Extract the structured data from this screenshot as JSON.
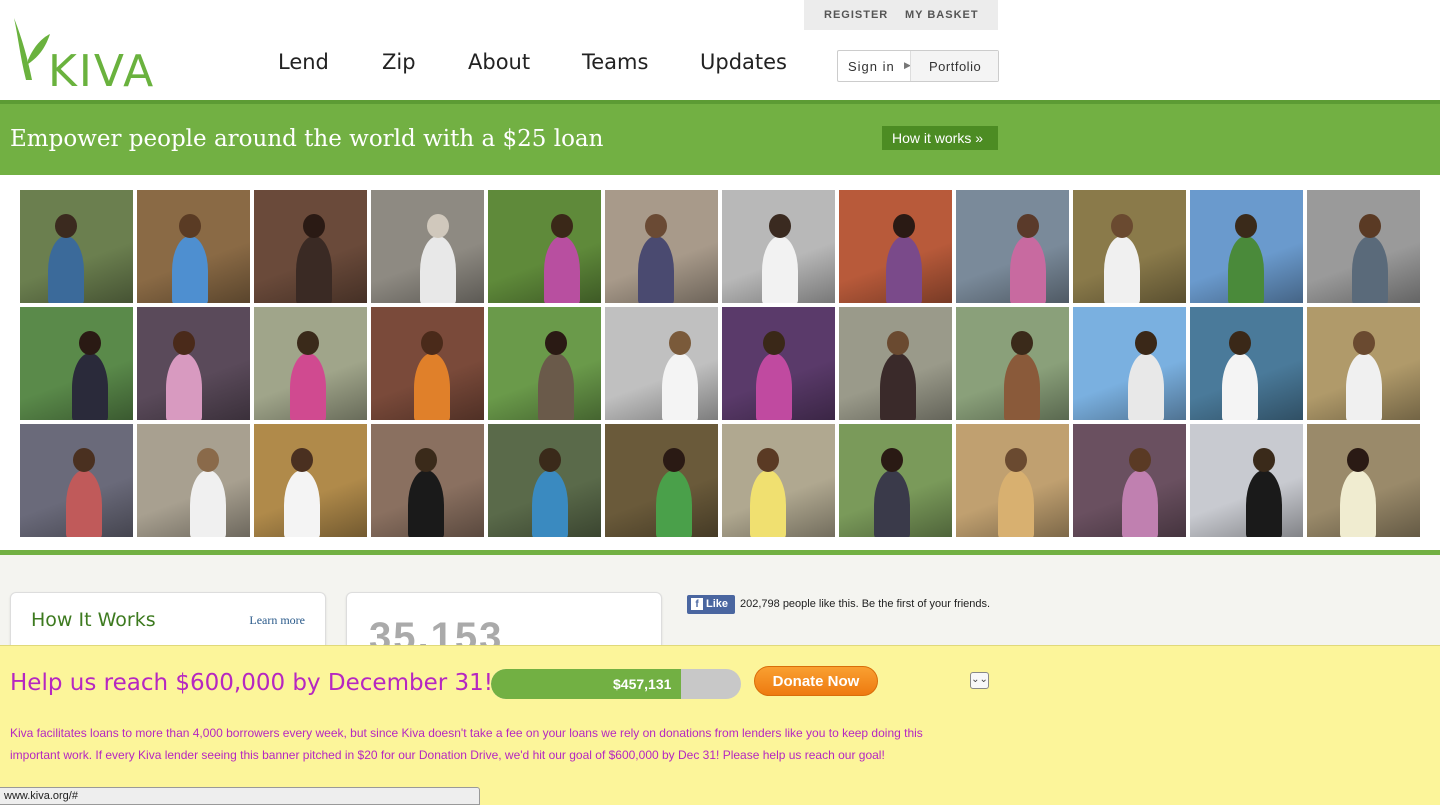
{
  "header": {
    "logo_text": "KIVA",
    "nav": [
      "Lend",
      "Zip",
      "About",
      "Teams",
      "Updates"
    ],
    "util": {
      "register": "REGISTER",
      "basket": "MY BASKET"
    },
    "signin": {
      "label": "Sign in",
      "portfolio": "Portfolio"
    }
  },
  "banner": {
    "title": "Empower people around the world with a $25 loan",
    "how_it_works": "How it works »"
  },
  "photos": [
    {
      "bg": "#6b7f4f",
      "fig": "#3b6a9a",
      "head": "#3b2a1f"
    },
    {
      "bg": "#8a6a45",
      "fig": "#4e8fd0",
      "head": "#5a3b24"
    },
    {
      "bg": "#6a4a3a",
      "fig": "#3a2a24",
      "head": "#2a1a14"
    },
    {
      "bg": "#8e8a82",
      "fig": "#e8e8e8",
      "head": "#d0c8bc"
    },
    {
      "bg": "#5f8a3a",
      "fig": "#b84fa0",
      "head": "#3a2818"
    },
    {
      "bg": "#a89a8a",
      "fig": "#4a4a70",
      "head": "#6a4a34"
    },
    {
      "bg": "#b8b8b8",
      "fig": "#f2f2f2",
      "head": "#3a2a20"
    },
    {
      "bg": "#b85a3a",
      "fig": "#7a4a8a",
      "head": "#2a1a14"
    },
    {
      "bg": "#7a8a9a",
      "fig": "#c86aa0",
      "head": "#5a3a2a"
    },
    {
      "bg": "#8a7a4a",
      "fig": "#f0f0f0",
      "head": "#6a4a30"
    },
    {
      "bg": "#6a9acd",
      "fig": "#4a8a3a",
      "head": "#3a2a1a"
    },
    {
      "bg": "#9a9a9a",
      "fig": "#5a6a7a",
      "head": "#5a3a24"
    },
    {
      "bg": "#5a8a4a",
      "fig": "#2a2a3a",
      "head": "#2a1a14"
    },
    {
      "bg": "#5a4a5a",
      "fig": "#d89ac0",
      "head": "#4a2a1a"
    },
    {
      "bg": "#a0a58a",
      "fig": "#d04a90",
      "head": "#3a2a1a"
    },
    {
      "bg": "#7a4a3a",
      "fig": "#e0802a",
      "head": "#4a2a1a"
    },
    {
      "bg": "#6a9a4a",
      "fig": "#6a5a4a",
      "head": "#2a1a14"
    },
    {
      "bg": "#c0c0c0",
      "fig": "#f4f4f4",
      "head": "#7a5a3a"
    },
    {
      "bg": "#5a3a6a",
      "fig": "#c04aa0",
      "head": "#3a2818"
    },
    {
      "bg": "#9a9a8a",
      "fig": "#3a2a2a",
      "head": "#6a4a30"
    },
    {
      "bg": "#8aa07a",
      "fig": "#8a5a3a",
      "head": "#3a2a1a"
    },
    {
      "bg": "#7ab0e0",
      "fig": "#e8e8e8",
      "head": "#3a2818"
    },
    {
      "bg": "#4a7a9a",
      "fig": "#f4f4f4",
      "head": "#3a2818"
    },
    {
      "bg": "#b09a6a",
      "fig": "#f0f0f0",
      "head": "#6a4a30"
    },
    {
      "bg": "#6a6a7a",
      "fig": "#c05a5a",
      "head": "#4a3020"
    },
    {
      "bg": "#a8a090",
      "fig": "#f0f0f0",
      "head": "#8a6a4a"
    },
    {
      "bg": "#b08a4a",
      "fig": "#f4f4f4",
      "head": "#4a3020"
    },
    {
      "bg": "#8a7060",
      "fig": "#1a1a1a",
      "head": "#3a2a1a"
    },
    {
      "bg": "#5a6a4a",
      "fig": "#3a8ac0",
      "head": "#3a2a1a"
    },
    {
      "bg": "#6a5a3a",
      "fig": "#4aa04a",
      "head": "#2a1a14"
    },
    {
      "bg": "#b0a890",
      "fig": "#f0e070",
      "head": "#5a3a24"
    },
    {
      "bg": "#7a9a5a",
      "fig": "#3a3a4a",
      "head": "#2a1a14"
    },
    {
      "bg": "#c0a070",
      "fig": "#d8b070",
      "head": "#6a4a30"
    },
    {
      "bg": "#6a5060",
      "fig": "#c080b0",
      "head": "#5a3a24"
    },
    {
      "bg": "#c8cad0",
      "fig": "#1a1a1a",
      "head": "#3a2a1a"
    },
    {
      "bg": "#9a8a6a",
      "fig": "#f0ecd0",
      "head": "#2a1a14"
    }
  ],
  "cards": {
    "how_it_works": {
      "title": "How It Works",
      "learn_more": "Learn more"
    },
    "counter": "35,153"
  },
  "facebook": {
    "like": "Like",
    "text": "202,798 people like this. Be the first of your friends."
  },
  "donation": {
    "title": "Help us reach $600,000 by December 31!",
    "amount": "$457,131",
    "progress": 0.76,
    "button": "Donate Now",
    "body": "Kiva facilitates loans to more than 4,000 borrowers every week, but since Kiva doesn't take a fee on your loans we rely on donations from lenders like you to keep doing this important work. If every Kiva lender seeing this banner pitched in $20 for our Donation Drive, we'd hit our goal of $600,000 by Dec 31! Please help us reach our goal!"
  },
  "status": {
    "url": "www.kiva.org/#"
  },
  "colors": {
    "brand_green": "#72b043",
    "donate_orange": "#f28a1f",
    "donation_purple": "#b627c1"
  }
}
